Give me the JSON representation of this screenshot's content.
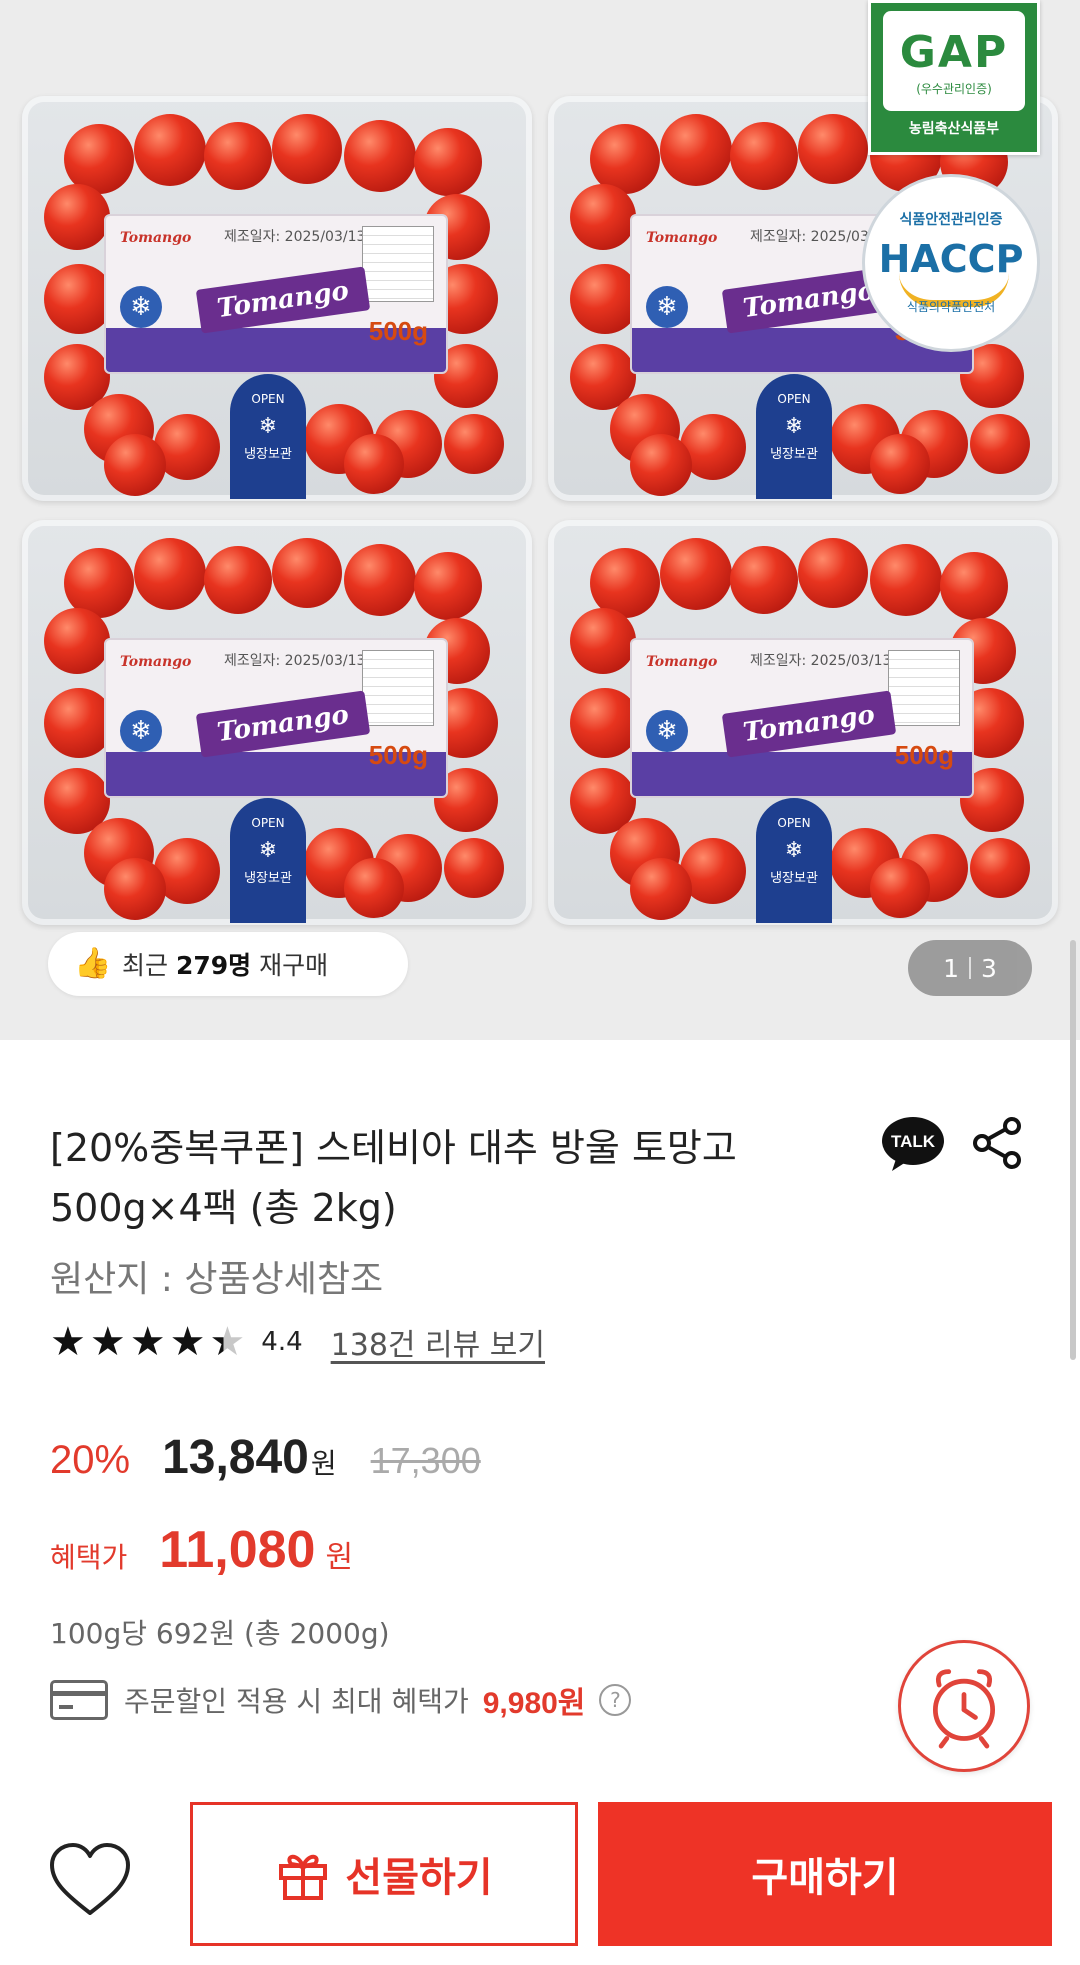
{
  "hero": {
    "pack_label": {
      "brand": "Tomango",
      "mini_brand": "Tomango",
      "date": "제조일자: 2025/03/13",
      "weight": "500g",
      "tab_open": "OPEN",
      "tab_storage": "냉장보관"
    },
    "gap_badge": {
      "title": "GAP",
      "subtitle": "(우수관리인증)",
      "ministry": "농림축산식품부"
    },
    "haccp_badge": {
      "top": "식품안전관리인증",
      "mark": "HACCP",
      "bottom": "식품의약품안전처"
    },
    "rebuy": {
      "prefix": "최근",
      "count": "279명",
      "suffix": "재구매"
    },
    "counter": {
      "current": "1",
      "total": "3"
    }
  },
  "product": {
    "title": "[20%중복쿠폰] 스테비아 대추 방울 토망고 500g×4팩 (총 2kg)",
    "origin": "원산지 : 상품상세참조",
    "rating": "4.4",
    "review_link": "138건 리뷰 보기"
  },
  "icons": {
    "talk": "TALK",
    "help": "?"
  },
  "pricing": {
    "discount": "20%",
    "price": "13,840",
    "won": "원",
    "original": "17,300",
    "benefit_label": "혜택가",
    "benefit_price": "11,080",
    "benefit_won": "원",
    "unit_price": "100g당 692원 (총 2000g)",
    "max_benefit_text": "주문할인 적용 시 최대 혜택가",
    "max_benefit_price": "9,980원"
  },
  "actions": {
    "gift_label": "선물하기",
    "buy_label": "구매하기"
  },
  "colors": {
    "accent": "#ee3326",
    "price_red": "#e23a2c",
    "gap_green": "#2b8a3e",
    "haccp_blue": "#1b6fa6"
  }
}
